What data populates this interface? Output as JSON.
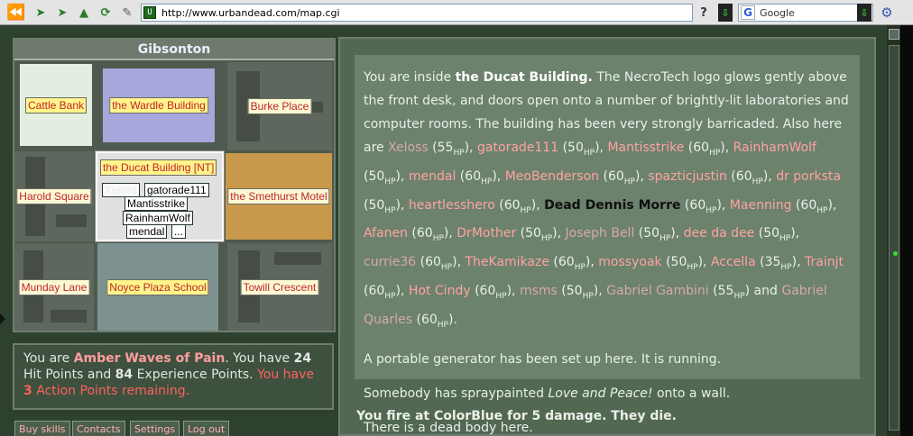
{
  "browser": {
    "url": "http://www.urbandead.com/map.cgi",
    "url_favicon": "U",
    "search_engine": "Google",
    "nav_icons": [
      "back-icon",
      "forward-icon",
      "reload-icon",
      "stop-icon",
      "home-icon",
      "bookmark-icon"
    ]
  },
  "map": {
    "title": "Gibsonton",
    "cells": [
      {
        "name": "Cattle Bank",
        "style": "bg-white"
      },
      {
        "name": "the Wardle Building",
        "style": "bg-lav"
      },
      {
        "name": "Burke Place",
        "style": "bg-street"
      },
      {
        "name": "Harold Square",
        "style": "bg-street"
      },
      {
        "name": "the Ducat Building [NT]",
        "style": "current"
      },
      {
        "name": "the Smethurst Motel",
        "style": "bg-gold"
      },
      {
        "name": "Munday Lane",
        "style": "bg-street"
      },
      {
        "name": "Noyce Plaza School",
        "style": "bg-grey"
      },
      {
        "name": "Towill Crescent",
        "style": "bg-street"
      }
    ],
    "current_chips": [
      "Xeloss",
      "gatorade111",
      "Mantisstrike",
      "RainhamWolf",
      "mendal",
      "..."
    ]
  },
  "status": {
    "prefix": "You are ",
    "name": "Amber Waves of Pain",
    "mid1": ". You have ",
    "hp": "24",
    "mid2": " Hit Points and ",
    "xp": "84",
    "mid3": " Experience Points. ",
    "ap_pre": "You have ",
    "ap": "3",
    "ap_post": " Action Points remaining."
  },
  "actions": [
    "Buy skills",
    "Contacts",
    "Settings",
    "Log out"
  ],
  "description": {
    "p1_pre": "You are inside ",
    "building": "the Ducat Building.",
    "p1_text": " The NecroTech logo glows gently above the front desk, and doors open onto a number of brightly-lit laboratories and computer rooms. The building has been very strongly barricaded. Also here are ",
    "hp_label": "HP",
    "players": [
      {
        "name": "Xeloss",
        "hp": "55",
        "style": "dim"
      },
      {
        "name": "gatorade111",
        "hp": "50",
        "style": ""
      },
      {
        "name": "Mantisstrike",
        "hp": "60",
        "style": ""
      },
      {
        "name": "RainhamWolf",
        "hp": "50",
        "style": ""
      },
      {
        "name": "mendal",
        "hp": "60",
        "style": ""
      },
      {
        "name": "MeoBenderson",
        "hp": "60",
        "style": ""
      },
      {
        "name": "spazticjustin",
        "hp": "60",
        "style": ""
      },
      {
        "name": "dr porksta",
        "hp": "50",
        "style": ""
      },
      {
        "name": "heartlesshero",
        "hp": "60",
        "style": ""
      },
      {
        "name": "Dead Dennis Morre",
        "hp": "60",
        "style": "dark"
      },
      {
        "name": "Maenning",
        "hp": "60",
        "style": ""
      },
      {
        "name": "Afanen",
        "hp": "60",
        "style": ""
      },
      {
        "name": "DrMother",
        "hp": "50",
        "style": ""
      },
      {
        "name": "Joseph Bell",
        "hp": "50",
        "style": "dim"
      },
      {
        "name": "dee da dee",
        "hp": "50",
        "style": ""
      },
      {
        "name": "currie36",
        "hp": "60",
        "style": "dim"
      },
      {
        "name": "TheKamikaze",
        "hp": "60",
        "style": ""
      },
      {
        "name": "mossyoak",
        "hp": "50",
        "style": ""
      },
      {
        "name": "Accella",
        "hp": "35",
        "style": ""
      },
      {
        "name": "Trainjt",
        "hp": "60",
        "style": ""
      },
      {
        "name": "Hot Cindy",
        "hp": "60",
        "style": ""
      },
      {
        "name": "msms",
        "hp": "50",
        "style": "dim"
      },
      {
        "name": "Gabriel Gambini",
        "hp": "55",
        "style": "dim"
      },
      {
        "name": "Gabriel Quarles",
        "hp": "60",
        "style": "dim"
      }
    ],
    "and_word": " and ",
    "p2": "A portable generator has been set up here. It is running.",
    "p3_pre": "Somebody has spraypainted ",
    "p3_em": "Love and Peace!",
    "p3_post": " onto a wall.",
    "p4": "There is a dead body here."
  },
  "message": "You fire at ColorBlue for 5 damage. They die."
}
